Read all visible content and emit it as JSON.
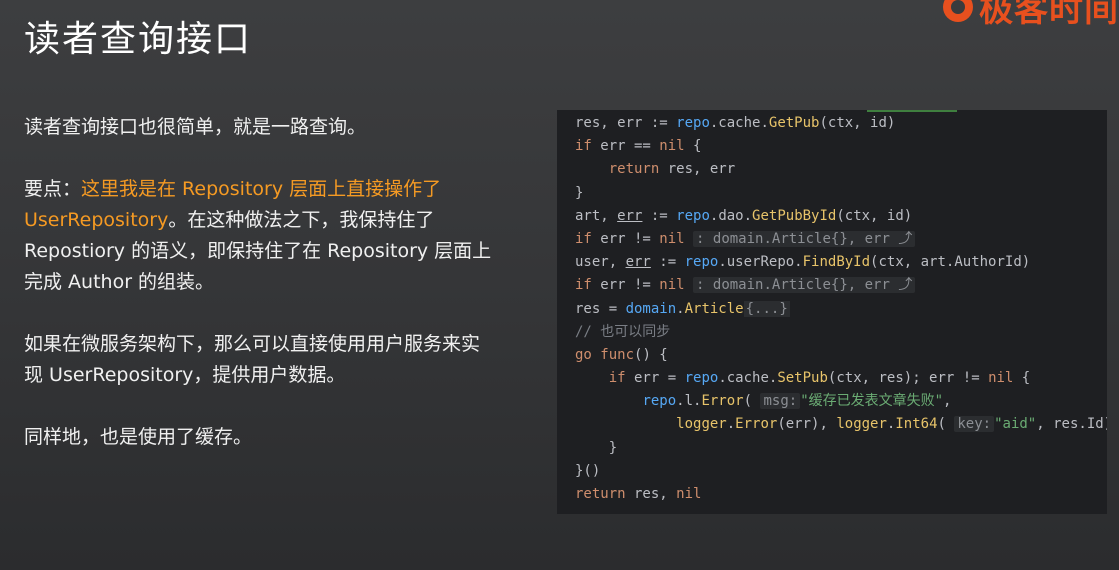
{
  "slide": {
    "title": "读者查询接口",
    "logo_text": "极客时间"
  },
  "text": {
    "p1": "读者查询接口也很简单，就是一路查询。",
    "p2_prefix": "要点：",
    "p2_highlight": "这里我是在 Repository 层面上直接操作了 UserRepository",
    "p2_rest": "。在这种做法之下，我保持住了 Repostiory 的语义，即保持住了在 Repository 层面上完成 Author 的组装。",
    "p3": "如果在微服务架构下，那么可以直接使用用户服务来实现 UserRepository，提供用户数据。",
    "p4": "同样地，也是使用了缓存。"
  },
  "code": {
    "hint_domain_article": ": domain.Article{}, err ⤴",
    "fold_braces": "{...}",
    "comment_sync": "// 也可以同步",
    "hint_msg": "msg:",
    "str_msg": "\"缓存已发表文章失败\"",
    "hint_key": "key:",
    "str_aid": "\"aid\""
  }
}
